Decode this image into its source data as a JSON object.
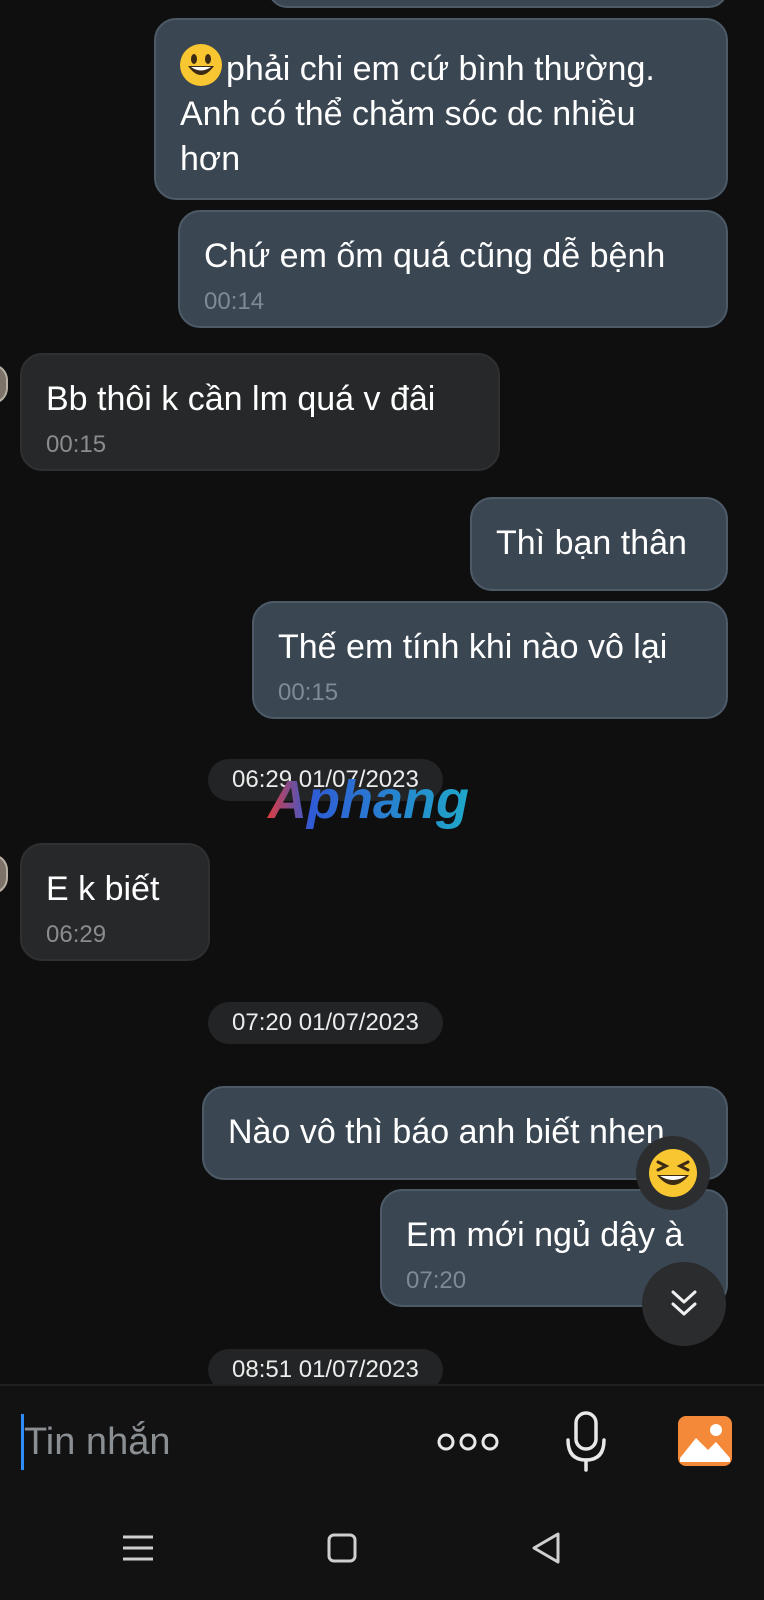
{
  "messages": [
    {
      "dir": "out",
      "text": "phải chi em cứ bình thường. Anh có thể chăm sóc dc nhiều hơn",
      "emoji": "grinning-face",
      "time": ""
    },
    {
      "dir": "out",
      "text": "Chứ em ốm quá cũng dễ bệnh",
      "time": "00:14"
    },
    {
      "dir": "in",
      "text": "Bb thôi k cần lm quá v đâi",
      "time": "00:15"
    },
    {
      "dir": "out",
      "text": "Thì bạn thân",
      "time": ""
    },
    {
      "dir": "out",
      "text": "Thế em tính khi nào vô lại",
      "time": "00:15"
    },
    {
      "dir": "in",
      "text": "E k biết",
      "time": "06:29"
    },
    {
      "dir": "out",
      "text": "Nào vô thì báo anh biết nhen",
      "time": ""
    },
    {
      "dir": "out",
      "text": "Em mới ngủ dậy à",
      "time": "07:20"
    }
  ],
  "date_separators": [
    "06:29 01/07/2023",
    "07:20 01/07/2023",
    "08:51 01/07/2023"
  ],
  "watermark": {
    "text": "Aphang"
  },
  "reaction": {
    "icon": "squinting-grin-emoji"
  },
  "scroll_button": {
    "icon": "double-chevron-down-icon"
  },
  "input": {
    "placeholder": "Tin nhắn",
    "value": ""
  },
  "toolbar": {
    "more_icon": "more-dots-icon",
    "mic_icon": "microphone-icon",
    "image_icon": "image-gallery-icon"
  },
  "nav": {
    "recents": "recents-icon",
    "home": "home-icon",
    "back": "back-icon"
  },
  "colors": {
    "background": "#0f0f10",
    "outgoing_bubble": "#3a4652",
    "incoming_bubble": "#262829",
    "accent_cursor": "#2f8cff",
    "image_button": "#f5893a"
  }
}
